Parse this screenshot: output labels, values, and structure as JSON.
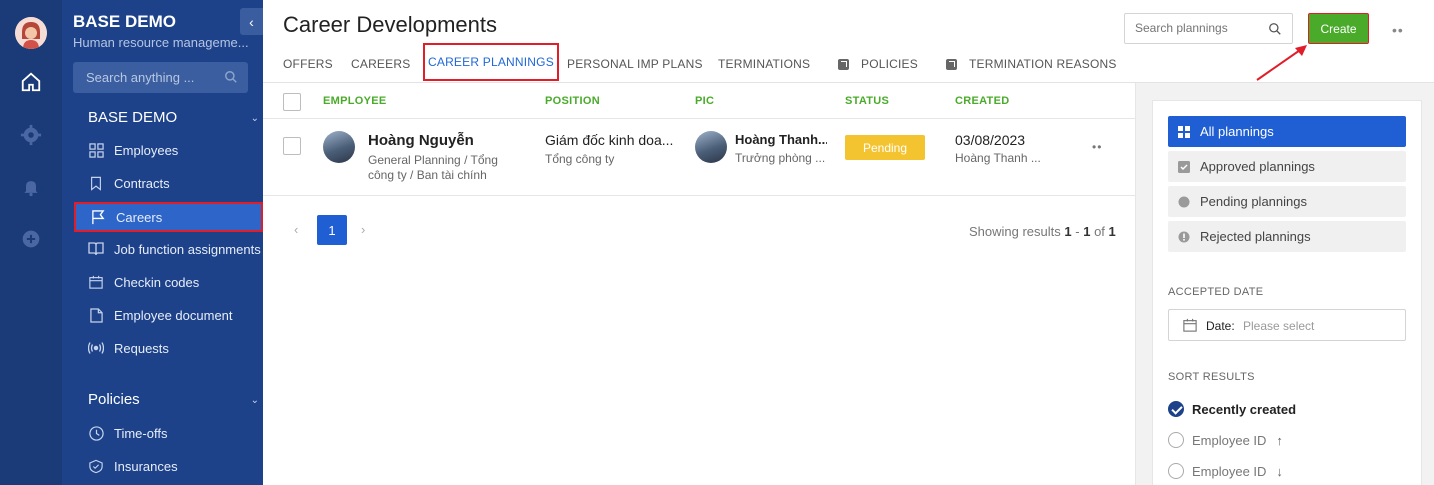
{
  "sidebar": {
    "org_title": "BASE DEMO",
    "org_subtitle": "Human resource manageme...",
    "search_placeholder": "Search anything ...",
    "section1": "BASE DEMO",
    "items": [
      {
        "label": "Employees"
      },
      {
        "label": "Contracts"
      },
      {
        "label": "Careers"
      },
      {
        "label": "Job function assignments"
      },
      {
        "label": "Checkin codes"
      },
      {
        "label": "Employee document"
      },
      {
        "label": "Requests"
      }
    ],
    "section2": "Policies",
    "items2": [
      {
        "label": "Time-offs"
      },
      {
        "label": "Insurances"
      }
    ]
  },
  "header": {
    "title": "Career Developments",
    "search_placeholder": "Search plannings",
    "create_label": "Create"
  },
  "tabs": [
    {
      "label": "OFFERS"
    },
    {
      "label": "CAREERS"
    },
    {
      "label": "CAREER PLANNINGS"
    },
    {
      "label": "PERSONAL IMP PLANS"
    },
    {
      "label": "TERMINATIONS"
    },
    {
      "label": "POLICIES"
    },
    {
      "label": "TERMINATION REASONS"
    }
  ],
  "table": {
    "columns": [
      "EMPLOYEE",
      "POSITION",
      "PIC",
      "STATUS",
      "CREATED"
    ],
    "rows": [
      {
        "employee_name": "Hoàng Nguyễn",
        "employee_detail": "General Planning / Tổng công ty / Ban tài chính",
        "position": "Giám đốc kinh doa...",
        "position_sub": "Tổng công ty",
        "pic_name": "Hoàng Thanh...",
        "pic_sub": "Trưởng phòng ...",
        "status": "Pending",
        "created": "03/08/2023",
        "created_by": "Hoàng Thanh ..."
      }
    ]
  },
  "pagination": {
    "current_page": "1",
    "showing_prefix": "Showing results",
    "from": "1",
    "to": "1",
    "of_word": "of",
    "total": "1"
  },
  "filters": {
    "buttons": [
      {
        "label": "All plannings"
      },
      {
        "label": "Approved plannings"
      },
      {
        "label": "Pending plannings"
      },
      {
        "label": "Rejected plannings"
      }
    ],
    "accepted_date_label": "ACCEPTED DATE",
    "date_field_label": "Date:",
    "date_placeholder": "Please select",
    "sort_label": "SORT RESULTS",
    "sort_options": [
      {
        "label": "Recently created"
      },
      {
        "label": "Employee ID"
      },
      {
        "label": "Employee ID"
      }
    ]
  },
  "colors": {
    "sidebar_bg": "#1d4289",
    "rail_bg": "#1a3a78",
    "accent_blue": "#1f5ed3",
    "create_green": "#4aab2b",
    "status_pending": "#f4c430",
    "annotation_red": "#e11d2a"
  }
}
